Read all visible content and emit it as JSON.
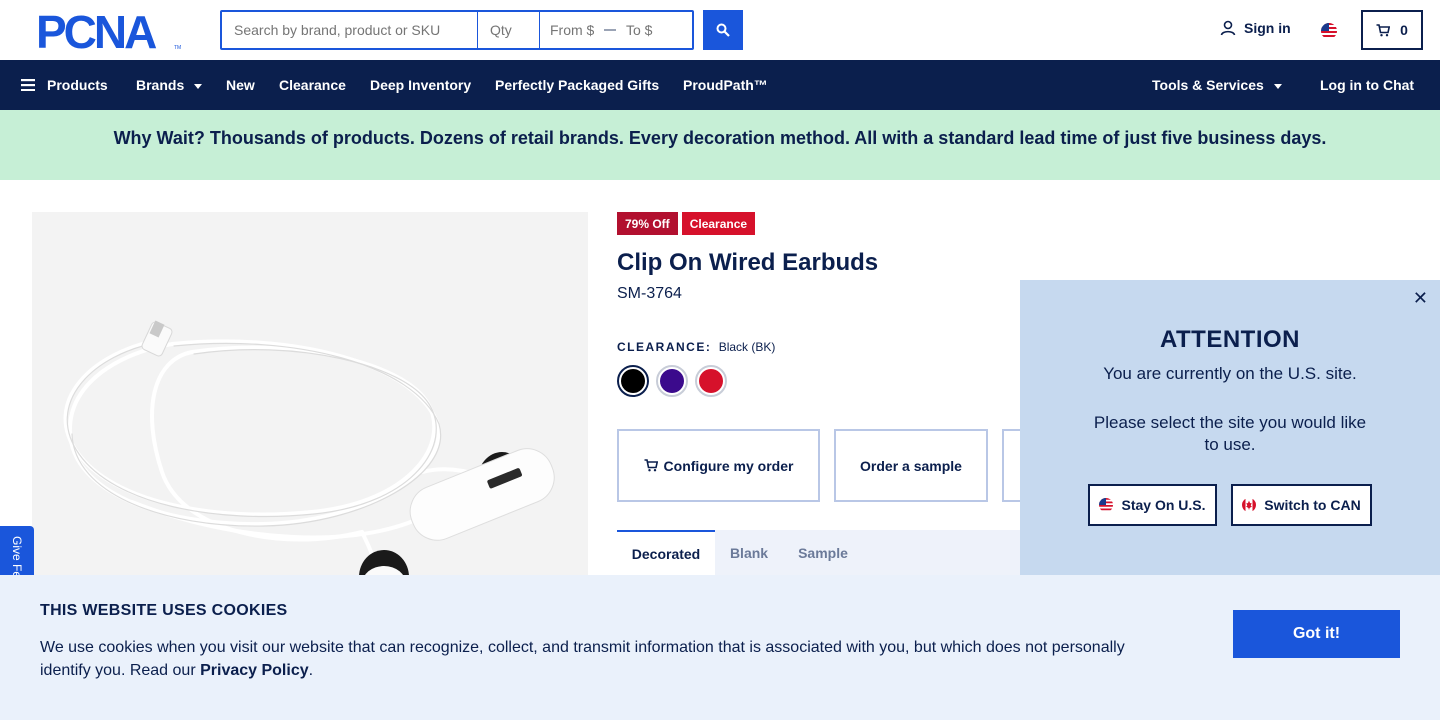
{
  "header": {
    "logo_text": "PCNA",
    "search_placeholder": "Search by brand, product or SKU",
    "qty_placeholder": "Qty",
    "price_from_placeholder": "From $",
    "price_to_placeholder": "To $",
    "signin_label": "Sign in",
    "cart_count": "0",
    "search_icon": "search-icon",
    "user_icon": "user-icon",
    "cart_icon": "cart-icon"
  },
  "nav": {
    "products": "Products",
    "brands": "Brands",
    "new": "New",
    "clearance": "Clearance",
    "deep_inventory": "Deep Inventory",
    "packaged_gifts": "Perfectly Packaged Gifts",
    "proudpath": "ProudPath™",
    "tools_services": "Tools & Services",
    "chat_login": "Log in to Chat"
  },
  "promo": {
    "text": "Why Wait? Thousands of products. Dozens of retail brands. Every decoration method. All with a standard lead time of just five business days."
  },
  "product": {
    "badge_discount": "79% Off",
    "badge_clearance": "Clearance",
    "title": "Clip On Wired Earbuds",
    "sku": "SM-3764",
    "color_label": "CLEARANCE:",
    "color_value": "Black (BK)",
    "swatches": [
      {
        "name": "Black",
        "hex": "#000000"
      },
      {
        "name": "Purple",
        "hex": "#3b0a8c"
      },
      {
        "name": "Red",
        "hex": "#d6112b"
      }
    ],
    "configure_label": "Configure my order",
    "sample_label": "Order a sample",
    "tabs": [
      "Decorated",
      "Blank",
      "Sample"
    ]
  },
  "feedback": {
    "label": "Give Feedback"
  },
  "attention": {
    "title": "ATTENTION",
    "line1": "You are currently on the U.S. site.",
    "line2": "Please select the site you would like to use.",
    "stay_label": "Stay On U.S.",
    "switch_label": "Switch to CAN",
    "close_glyph": "✕"
  },
  "cookie": {
    "title": "THIS WEBSITE USES COOKIES",
    "text": "We use cookies when you visit our website that can recognize, collect, and transmit information that is associated with you, but which does not personally identify you. Read our ",
    "link": "Privacy Policy",
    "end": ".",
    "button": "Got it!"
  },
  "colors": {
    "navy": "#0b1f4d",
    "blue": "#1a56db",
    "promo_green": "#c6efd6",
    "attention_bg": "#c6d9ef",
    "cookie_bg": "#eaf1fb"
  }
}
